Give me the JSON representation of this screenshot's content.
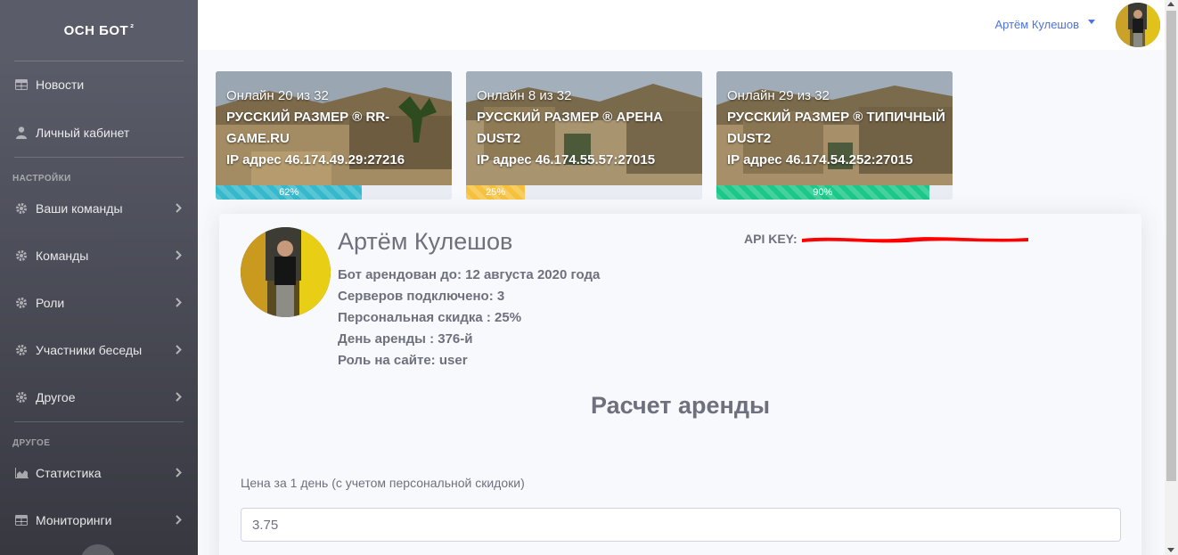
{
  "sidebar": {
    "brand": "ОСН БОТ",
    "brand_sup": "²",
    "items": [
      {
        "label": "Новости",
        "icon": "table-icon"
      },
      {
        "label": "Личный кабинет",
        "icon": "user-icon"
      }
    ],
    "section_settings": "НАСТРОЙКИ",
    "settings_items": [
      {
        "label": "Ваши команды",
        "icon": "gear-icon"
      },
      {
        "label": "Команды",
        "icon": "gear-icon"
      },
      {
        "label": "Роли",
        "icon": "gear-icon"
      },
      {
        "label": "Участники беседы",
        "icon": "gear-icon"
      },
      {
        "label": "Другое",
        "icon": "gear-icon"
      }
    ],
    "section_other": "ДРУГОЕ",
    "other_items": [
      {
        "label": "Статистика",
        "icon": "chart-area-icon"
      },
      {
        "label": "Мониторинги",
        "icon": "table-icon"
      }
    ]
  },
  "topbar": {
    "user_name": "Артём Кулешов"
  },
  "servers": [
    {
      "online": "Онлайн 20 из 32",
      "name": "РУССКИЙ РАЗМЕР ® RR-GAME.RU",
      "ip": "IP адрес 46.174.49.29:27216",
      "percent": 62,
      "percent_label": "62%",
      "color": "#36b9cc"
    },
    {
      "online": "Онлайн 8 из 32",
      "name": "РУССКИЙ РАЗМЕР ® АРЕНА DUST2",
      "ip": "IP адрес 46.174.55.57:27015",
      "percent": 25,
      "percent_label": "25%",
      "color": "#f6c23e"
    },
    {
      "online": "Онлайн 29 из 32",
      "name": "РУССКИЙ РАЗМЕР ® ТИПИЧНЫЙ DUST2",
      "ip": "IP адрес 46.174.54.252:27015",
      "percent": 90,
      "percent_label": "90%",
      "color": "#1cc88a"
    }
  ],
  "profile": {
    "name": "Артём Кулешов",
    "rented_until": "Бот арендован до: 12 августа 2020 года",
    "servers_connected": "Серверов подключено: 3",
    "discount": "Персональная скидка : 25%",
    "rent_day": "День аренды : 376-й",
    "role": "Роль на сайте: user",
    "api_key_label": "API KEY:"
  },
  "rent_calc": {
    "title": "Расчет аренды",
    "price_label": "Цена за 1 день (с учетом персональной скидоки)",
    "price_value": "3.75"
  },
  "colors": {
    "primary": "#4e73df",
    "info": "#36b9cc",
    "warning": "#f6c23e",
    "success": "#1cc88a",
    "redaction": "#ff0000"
  }
}
